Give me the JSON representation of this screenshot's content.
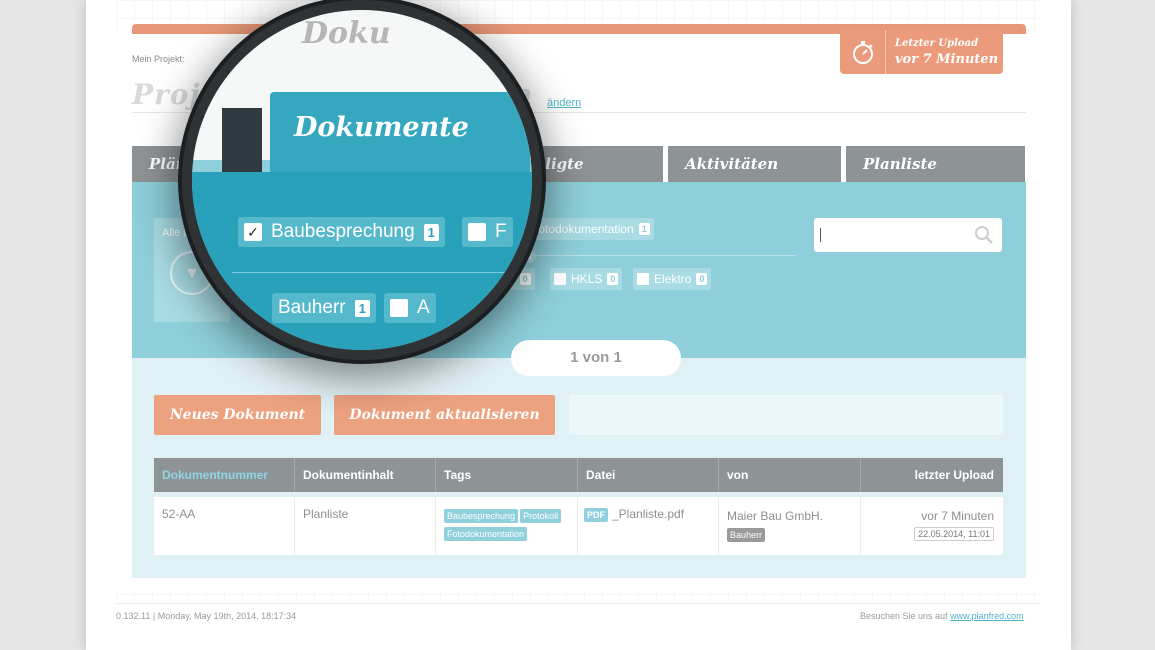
{
  "upload_badge": {
    "line1": "Letzter Upload",
    "line2": "vor 7 Minuten",
    "icon": "stopwatch-icon"
  },
  "project": {
    "label": "Mein Projekt:",
    "title_left": "Proje",
    "title_right": "n",
    "edit": "ändern"
  },
  "tabs": [
    {
      "label": "Pläne"
    },
    {
      "label": "eiligte"
    },
    {
      "label": "Aktivitäten"
    },
    {
      "label": "Planliste"
    }
  ],
  "filters": {
    "show_all": "Alle anzeige",
    "group1": [
      {
        "label": "Baubesprechung",
        "count": "1"
      },
      {
        "label": "Fotodokumentation",
        "count": "1"
      }
    ],
    "amp": "&",
    "group2": [
      {
        "label": "ker",
        "count": "0"
      },
      {
        "label": "HKLS",
        "count": "0"
      },
      {
        "label": "Elektro",
        "count": "0"
      }
    ],
    "search_placeholder": ""
  },
  "pagination": "1 von 1",
  "buttons": {
    "new": "Neues Dokument",
    "update": "Dokument aktualisieren"
  },
  "table": {
    "headers": [
      "Dokumentnummer",
      "Dokumentinhalt",
      "Tags",
      "Datei",
      "von",
      "letzter Upload"
    ],
    "rows": [
      {
        "nummer": "52-AA",
        "inhalt": "Planliste",
        "tags": [
          "Baubesprechung",
          "Protokoll",
          "Fotodokumentation"
        ],
        "file_badge": "PDF",
        "file": "_Planliste.pdf",
        "von": "Maier Bau GmbH.",
        "von_tag": "Bauherr",
        "upload": "vor 7 Minuten",
        "upload_date": "22.05.2014, 11:01"
      }
    ]
  },
  "footer": {
    "left": "0.132.11 | Monday, May 19th, 2014, 18:17:34",
    "right_prefix": "Besuchen Sie uns auf",
    "right_link": "www.planfred.com"
  },
  "magnifier": {
    "title_fragment": "Doku",
    "tab": "Dokumente",
    "chip1": {
      "label": "Baubesprechung",
      "count": "1"
    },
    "chip2_fragment": "F",
    "chip3": {
      "label": "Bauherr",
      "count": "1"
    },
    "chip4_fragment": "A"
  },
  "colors": {
    "accent": "#8ecfdb",
    "active_tab": "#35a8c0",
    "orange": "#eda27f",
    "tab_grey": "#8e9396"
  }
}
